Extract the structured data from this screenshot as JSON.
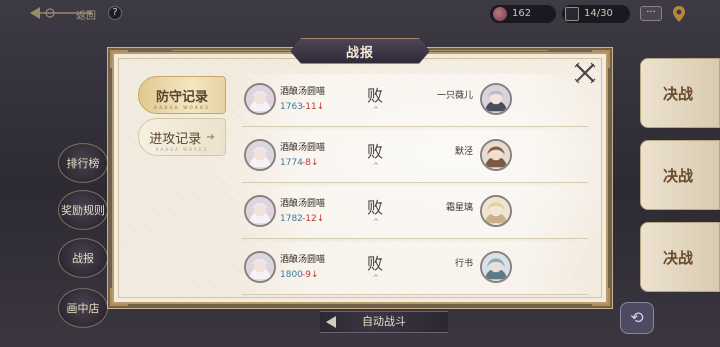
{
  "topbar": {
    "back_label": "返回",
    "help_symbol": "?",
    "coins": "162",
    "tickets": "14/30",
    "more_symbol": "···"
  },
  "sidebar": {
    "items": [
      {
        "label": "排行榜"
      },
      {
        "label": "奖励规则"
      },
      {
        "label": "战报"
      },
      {
        "label": "画中店"
      }
    ]
  },
  "right_cards": [
    {
      "label": "决战"
    },
    {
      "label": "决战"
    },
    {
      "label": "决战"
    }
  ],
  "bottom": {
    "auto_battle": "自动战斗",
    "refresh_symbol": "⟲"
  },
  "modal": {
    "title": "战报",
    "close_symbol": "✕",
    "tabs": [
      {
        "label": "防守记录",
        "sub": "RAAGA WORKS",
        "active": true
      },
      {
        "label": "进攻记录",
        "arrow": "➔",
        "sub": "RAAGA WORKS",
        "active": false
      }
    ],
    "records": [
      {
        "me": "酒酿汤圆喵",
        "score": "1763",
        "delta": "-11↓",
        "result": "败",
        "mark": "^",
        "opponent": "一只薇儿"
      },
      {
        "me": "酒酿汤圆喵",
        "score": "1774",
        "delta": "-8↓",
        "result": "败",
        "mark": "^",
        "opponent": "默泾"
      },
      {
        "me": "酒酿汤圆喵",
        "score": "1782",
        "delta": "-12↓",
        "result": "败",
        "mark": "^",
        "opponent": "霜星璃"
      },
      {
        "me": "酒酿汤圆喵",
        "score": "1800",
        "delta": "-9↓",
        "result": "败",
        "mark": "^",
        "opponent": "行书"
      }
    ]
  },
  "colors": {
    "score_blue": "#3f78a2",
    "delta_red": "#c2342c",
    "title_bar": "#3a3344",
    "parchment": "#f2ebde"
  },
  "icons": {
    "back": "ornate-back-arrow-icon",
    "help": "help-icon",
    "coin": "coin-icon",
    "ticket": "ticket-icon",
    "more": "more-icon",
    "location": "location-pin-icon",
    "close": "close-icon",
    "refresh": "refresh-icon",
    "avatar": "avatar-portrait"
  }
}
